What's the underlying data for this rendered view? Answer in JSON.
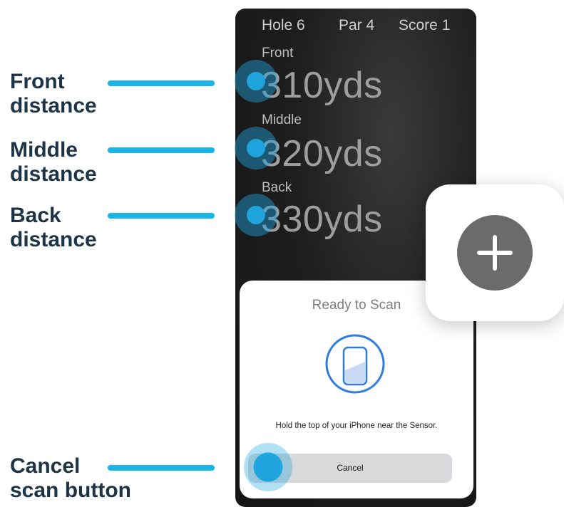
{
  "callouts": {
    "front": "Front\ndistance",
    "middle": "Middle\ndistance",
    "back": "Back\ndistance",
    "cancel": "Cancel\nscan button"
  },
  "phone": {
    "hole": "Hole 6",
    "par": "Par 4",
    "score": "Score 1",
    "front_label": "Front",
    "front_value": "310yds",
    "middle_label": "Middle",
    "middle_value": "320yds",
    "back_label": "Back",
    "back_value": "330yds"
  },
  "sheet": {
    "title": "Ready to Scan",
    "message": "Hold the top of your iPhone near the Sensor.",
    "cancel_label": "Cancel"
  },
  "icons": {
    "scan": "phone-scan-icon",
    "add": "plus-icon"
  },
  "colors": {
    "accent": "#1ab4e6",
    "scan_ring": "#2f7de1",
    "callout_text": "#1d3446"
  }
}
